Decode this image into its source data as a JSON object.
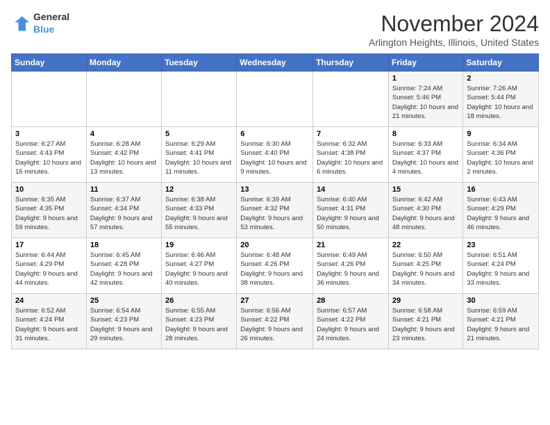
{
  "logo": {
    "general": "General",
    "blue": "Blue"
  },
  "header": {
    "month": "November 2024",
    "location": "Arlington Heights, Illinois, United States"
  },
  "weekdays": [
    "Sunday",
    "Monday",
    "Tuesday",
    "Wednesday",
    "Thursday",
    "Friday",
    "Saturday"
  ],
  "weeks": [
    [
      {
        "day": "",
        "sunrise": "",
        "sunset": "",
        "daylight": ""
      },
      {
        "day": "",
        "sunrise": "",
        "sunset": "",
        "daylight": ""
      },
      {
        "day": "",
        "sunrise": "",
        "sunset": "",
        "daylight": ""
      },
      {
        "day": "",
        "sunrise": "",
        "sunset": "",
        "daylight": ""
      },
      {
        "day": "",
        "sunrise": "",
        "sunset": "",
        "daylight": ""
      },
      {
        "day": "1",
        "sunrise": "Sunrise: 7:24 AM",
        "sunset": "Sunset: 5:46 PM",
        "daylight": "Daylight: 10 hours and 21 minutes."
      },
      {
        "day": "2",
        "sunrise": "Sunrise: 7:26 AM",
        "sunset": "Sunset: 5:44 PM",
        "daylight": "Daylight: 10 hours and 18 minutes."
      }
    ],
    [
      {
        "day": "3",
        "sunrise": "Sunrise: 6:27 AM",
        "sunset": "Sunset: 4:43 PM",
        "daylight": "Daylight: 10 hours and 16 minutes."
      },
      {
        "day": "4",
        "sunrise": "Sunrise: 6:28 AM",
        "sunset": "Sunset: 4:42 PM",
        "daylight": "Daylight: 10 hours and 13 minutes."
      },
      {
        "day": "5",
        "sunrise": "Sunrise: 6:29 AM",
        "sunset": "Sunset: 4:41 PM",
        "daylight": "Daylight: 10 hours and 11 minutes."
      },
      {
        "day": "6",
        "sunrise": "Sunrise: 6:30 AM",
        "sunset": "Sunset: 4:40 PM",
        "daylight": "Daylight: 10 hours and 9 minutes."
      },
      {
        "day": "7",
        "sunrise": "Sunrise: 6:32 AM",
        "sunset": "Sunset: 4:38 PM",
        "daylight": "Daylight: 10 hours and 6 minutes."
      },
      {
        "day": "8",
        "sunrise": "Sunrise: 6:33 AM",
        "sunset": "Sunset: 4:37 PM",
        "daylight": "Daylight: 10 hours and 4 minutes."
      },
      {
        "day": "9",
        "sunrise": "Sunrise: 6:34 AM",
        "sunset": "Sunset: 4:36 PM",
        "daylight": "Daylight: 10 hours and 2 minutes."
      }
    ],
    [
      {
        "day": "10",
        "sunrise": "Sunrise: 6:35 AM",
        "sunset": "Sunset: 4:35 PM",
        "daylight": "Daylight: 9 hours and 59 minutes."
      },
      {
        "day": "11",
        "sunrise": "Sunrise: 6:37 AM",
        "sunset": "Sunset: 4:34 PM",
        "daylight": "Daylight: 9 hours and 57 minutes."
      },
      {
        "day": "12",
        "sunrise": "Sunrise: 6:38 AM",
        "sunset": "Sunset: 4:33 PM",
        "daylight": "Daylight: 9 hours and 55 minutes."
      },
      {
        "day": "13",
        "sunrise": "Sunrise: 6:39 AM",
        "sunset": "Sunset: 4:32 PM",
        "daylight": "Daylight: 9 hours and 53 minutes."
      },
      {
        "day": "14",
        "sunrise": "Sunrise: 6:40 AM",
        "sunset": "Sunset: 4:31 PM",
        "daylight": "Daylight: 9 hours and 50 minutes."
      },
      {
        "day": "15",
        "sunrise": "Sunrise: 6:42 AM",
        "sunset": "Sunset: 4:30 PM",
        "daylight": "Daylight: 9 hours and 48 minutes."
      },
      {
        "day": "16",
        "sunrise": "Sunrise: 6:43 AM",
        "sunset": "Sunset: 4:29 PM",
        "daylight": "Daylight: 9 hours and 46 minutes."
      }
    ],
    [
      {
        "day": "17",
        "sunrise": "Sunrise: 6:44 AM",
        "sunset": "Sunset: 4:29 PM",
        "daylight": "Daylight: 9 hours and 44 minutes."
      },
      {
        "day": "18",
        "sunrise": "Sunrise: 6:45 AM",
        "sunset": "Sunset: 4:28 PM",
        "daylight": "Daylight: 9 hours and 42 minutes."
      },
      {
        "day": "19",
        "sunrise": "Sunrise: 6:46 AM",
        "sunset": "Sunset: 4:27 PM",
        "daylight": "Daylight: 9 hours and 40 minutes."
      },
      {
        "day": "20",
        "sunrise": "Sunrise: 6:48 AM",
        "sunset": "Sunset: 4:26 PM",
        "daylight": "Daylight: 9 hours and 38 minutes."
      },
      {
        "day": "21",
        "sunrise": "Sunrise: 6:49 AM",
        "sunset": "Sunset: 4:26 PM",
        "daylight": "Daylight: 9 hours and 36 minutes."
      },
      {
        "day": "22",
        "sunrise": "Sunrise: 6:50 AM",
        "sunset": "Sunset: 4:25 PM",
        "daylight": "Daylight: 9 hours and 34 minutes."
      },
      {
        "day": "23",
        "sunrise": "Sunrise: 6:51 AM",
        "sunset": "Sunset: 4:24 PM",
        "daylight": "Daylight: 9 hours and 33 minutes."
      }
    ],
    [
      {
        "day": "24",
        "sunrise": "Sunrise: 6:52 AM",
        "sunset": "Sunset: 4:24 PM",
        "daylight": "Daylight: 9 hours and 31 minutes."
      },
      {
        "day": "25",
        "sunrise": "Sunrise: 6:54 AM",
        "sunset": "Sunset: 4:23 PM",
        "daylight": "Daylight: 9 hours and 29 minutes."
      },
      {
        "day": "26",
        "sunrise": "Sunrise: 6:55 AM",
        "sunset": "Sunset: 4:23 PM",
        "daylight": "Daylight: 9 hours and 28 minutes."
      },
      {
        "day": "27",
        "sunrise": "Sunrise: 6:56 AM",
        "sunset": "Sunset: 4:22 PM",
        "daylight": "Daylight: 9 hours and 26 minutes."
      },
      {
        "day": "28",
        "sunrise": "Sunrise: 6:57 AM",
        "sunset": "Sunset: 4:22 PM",
        "daylight": "Daylight: 9 hours and 24 minutes."
      },
      {
        "day": "29",
        "sunrise": "Sunrise: 6:58 AM",
        "sunset": "Sunset: 4:21 PM",
        "daylight": "Daylight: 9 hours and 23 minutes."
      },
      {
        "day": "30",
        "sunrise": "Sunrise: 6:59 AM",
        "sunset": "Sunset: 4:21 PM",
        "daylight": "Daylight: 9 hours and 21 minutes."
      }
    ]
  ]
}
